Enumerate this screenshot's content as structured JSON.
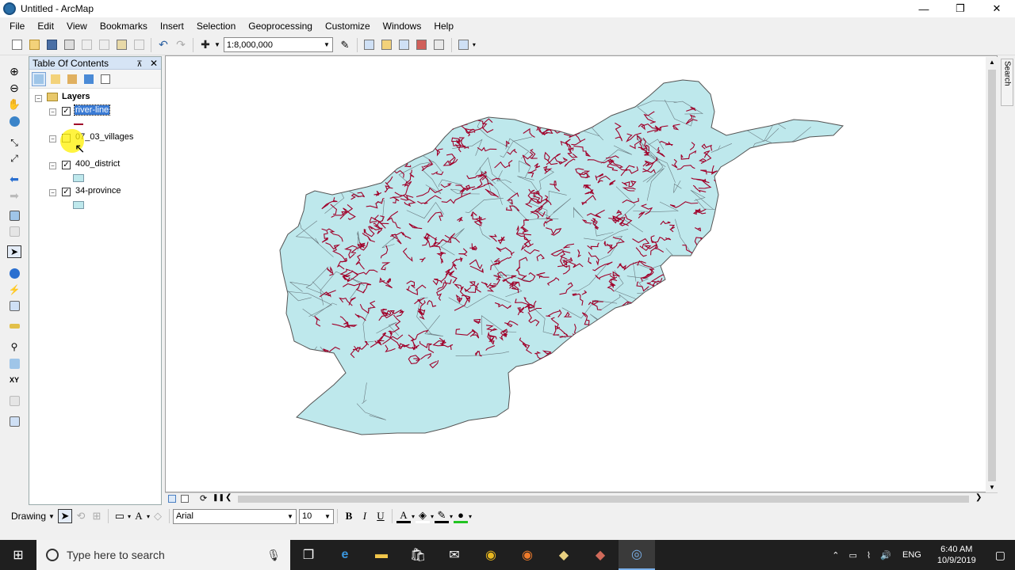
{
  "window": {
    "title": "Untitled - ArcMap",
    "minimize": "—",
    "maximize": "❐",
    "close": "✕"
  },
  "menu": [
    "File",
    "Edit",
    "View",
    "Bookmarks",
    "Insert",
    "Selection",
    "Geoprocessing",
    "Customize",
    "Windows",
    "Help"
  ],
  "toolbar": {
    "scale": "1:8,000,000"
  },
  "toc": {
    "title": "Table Of Contents",
    "pin": "⊼",
    "close": "✕",
    "root": "Layers",
    "layers": [
      {
        "name": "river-line",
        "checked": true,
        "selected": true
      },
      {
        "name": "07_03_villages",
        "checked": false,
        "selected": false
      },
      {
        "name": "400_district",
        "checked": true,
        "selected": false
      },
      {
        "name": "34-province",
        "checked": true,
        "selected": false
      }
    ]
  },
  "search_tab": "Search",
  "drawing": {
    "label": "Drawing",
    "font": "Arial",
    "size": "10",
    "bold": "B",
    "italic": "I",
    "underline": "U",
    "text_tool": "A"
  },
  "taskbar": {
    "search_placeholder": "Type here to search",
    "language": "ENG",
    "time": "6:40 AM",
    "date": "10/9/2019"
  },
  "colors": {
    "map_fill": "#bee8ec",
    "river": "#a0002a",
    "outline": "#555555",
    "taskbar": "#1f1f1f"
  }
}
